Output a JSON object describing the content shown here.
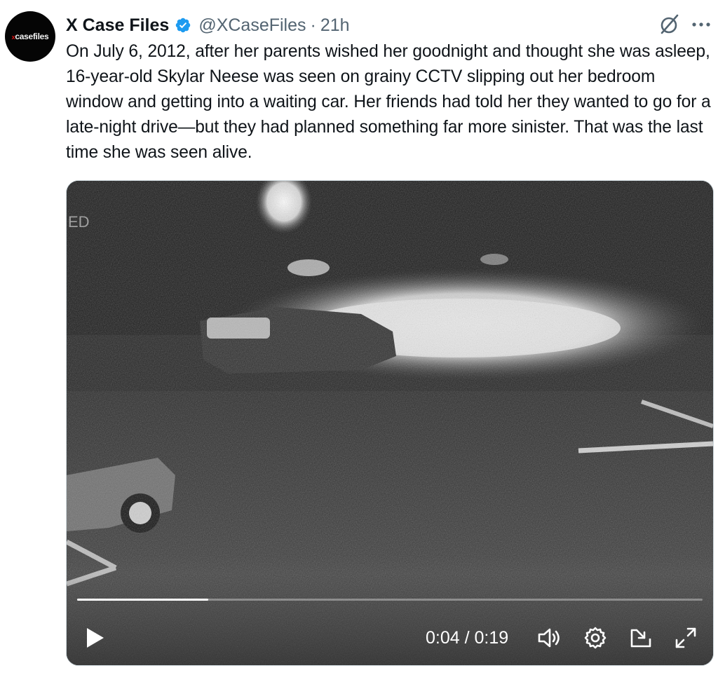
{
  "author": {
    "avatar_text": "casefiles",
    "avatar_accent": "x",
    "display_name": "X Case Files",
    "handle": "@XCaseFiles",
    "separator": "·",
    "time_ago": "21h",
    "verified": true,
    "verified_color": "#1d9bf0"
  },
  "tweet": {
    "text": "On July 6, 2012, after her parents wished her goodnight and thought she was asleep, 16-year-old Skylar Neese was seen on grainy CCTV slipping out her bedroom window and getting into a waiting car. Her friends had told her they wanted to go for a late-night drive—but they had planned something far more sinister. That was the last time she was seen alive."
  },
  "video": {
    "overlay_corner_text": "ED",
    "current_time": "0:04",
    "duration": "0:19",
    "time_label": "0:04 / 0:19",
    "progress_fraction": 0.21,
    "controls": {
      "play_icon": "play-icon",
      "volume_icon": "volume-icon",
      "settings_icon": "gear-icon",
      "pip_icon": "picture-in-picture-icon",
      "fullscreen_icon": "expand-icon"
    }
  },
  "actions": {
    "grok_icon": "grok-icon",
    "more_icon": "more-icon"
  }
}
